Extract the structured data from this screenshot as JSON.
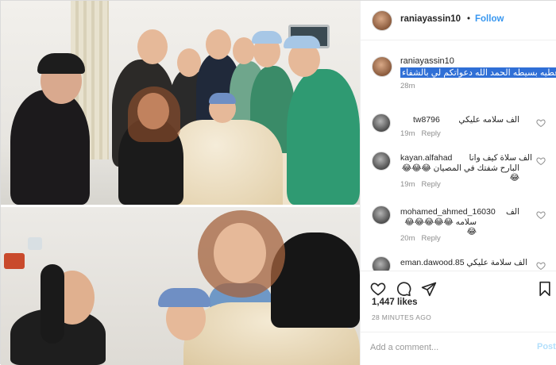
{
  "post": {
    "username": "raniayassin10",
    "follow_label": "Follow",
    "dot": "•",
    "caption": {
      "username": "raniayassin10",
      "text": "عطيه بسيطه الحمد الله دعواتكم لي بالشفاء",
      "time": "28m"
    },
    "comments": [
      {
        "user": "tw8796",
        "text": "الف سلامه عليكي",
        "text2": "",
        "time": "19m",
        "reply": "Reply"
      },
      {
        "user": "kayan.alfahad",
        "text": "الف سلاة كيف وانا",
        "text2": "البارح شفتك في المصيان 😂😂😂😂",
        "time": "19m",
        "reply": "Reply"
      },
      {
        "user": "mohamed_ahmed_16030",
        "text": "الف",
        "text2": "سلامه 😂😂😂😂😂😂",
        "time": "20m",
        "reply": "Reply"
      },
      {
        "user": "eman.dawood.85",
        "text": "الف سلامة عليكي و",
        "text2": "",
        "time": "",
        "reply": ""
      }
    ],
    "likes": "1,447 likes",
    "posted_ago": "28 MINUTES AGO",
    "add_comment_placeholder": "Add a comment...",
    "post_button": "Post"
  },
  "colors": {
    "accent": "#3897f0",
    "caption_highlight": "#2f6fd6",
    "muted": "#8e8e8e",
    "post_disabled": "#b2dffc"
  },
  "icons": [
    "heart-icon",
    "comment-icon",
    "share-icon",
    "bookmark-icon"
  ]
}
